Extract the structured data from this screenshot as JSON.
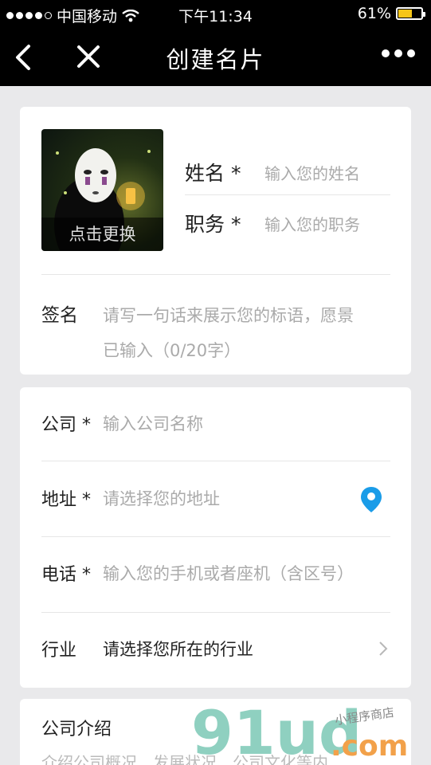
{
  "status_bar": {
    "carrier": "中国移动",
    "time": "下午11:34",
    "battery_text": "61%",
    "battery_level": 0.61,
    "battery_color": "#f5c518"
  },
  "nav": {
    "title": "创建名片",
    "back_icon": "chevron-left-icon",
    "close_icon": "close-icon",
    "more_icon": "more-dots-icon"
  },
  "profile": {
    "avatar_caption": "点击更换",
    "name_label": "姓名 *",
    "name_placeholder": "输入您的姓名",
    "job_label": "职务 *",
    "job_placeholder": "输入您的职务",
    "signature_label": "签名",
    "signature_placeholder": "请写一句话来展示您的标语，愿景",
    "signature_counter": "已输入（0/20字）"
  },
  "company": {
    "company_label": "公司 *",
    "company_placeholder": "输入公司名称",
    "address_label": "地址 *",
    "address_placeholder": "请选择您的地址",
    "address_icon": "location-pin-icon",
    "phone_label": "电话 *",
    "phone_placeholder": "输入您的手机或者座机（含区号）",
    "industry_label": "行业",
    "industry_value": "请选择您所在的行业",
    "industry_icon": "chevron-right-icon",
    "accent_color": "#1a9ce8"
  },
  "intro": {
    "label": "公司介绍",
    "placeholder": "介绍公司概况、发展状况、公司文化等内"
  },
  "watermark": {
    "big": "91ud",
    "com": ".com",
    "small": "小程序商店"
  }
}
